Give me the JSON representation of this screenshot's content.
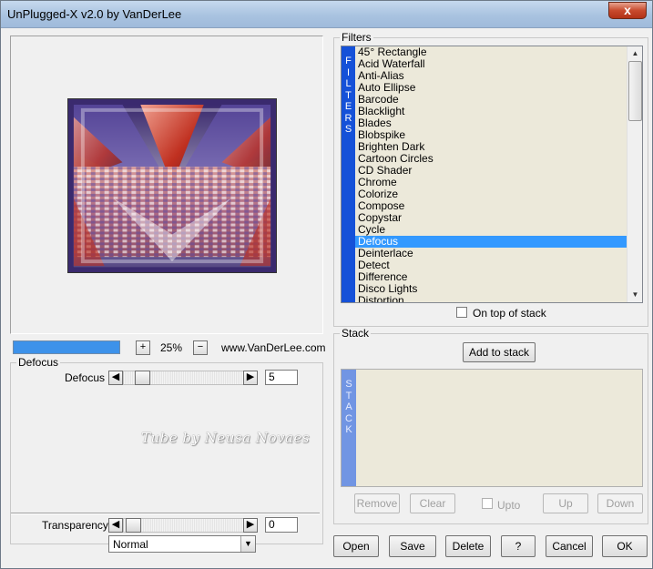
{
  "window": {
    "title": "UnPlugged-X v2.0 by VanDerLee",
    "close_glyph": "x"
  },
  "preview": {
    "zoom": "25%",
    "zoom_in": "+",
    "zoom_out": "−",
    "website": "www.VanDerLee.com",
    "progress_fraction": 1.0
  },
  "params": {
    "group_label": "Defocus",
    "defocus_label": "Defocus",
    "defocus_value": "5",
    "watermark": "Tube by Neusa Novaes",
    "transparency_label": "Transparency",
    "transparency_value": "0",
    "blend_mode": "Normal"
  },
  "filters": {
    "group_label": "Filters",
    "band_label": [
      "F",
      "I",
      "L",
      "T",
      "E",
      "R",
      "S"
    ],
    "items": [
      "45° Rectangle",
      "Acid Waterfall",
      "Anti-Alias",
      "Auto Ellipse",
      "Barcode",
      "Blacklight",
      "Blades",
      "Blobspike",
      "Brighten Dark",
      "Cartoon Circles",
      "CD Shader",
      "Chrome",
      "Colorize",
      "Compose",
      "Copystar",
      "Cycle",
      "Defocus",
      "Deinterlace",
      "Detect",
      "Difference",
      "Disco Lights",
      "Distortion"
    ],
    "selected": "Defocus",
    "on_top_label": "On top of stack"
  },
  "stack": {
    "group_label": "Stack",
    "add_label": "Add to stack",
    "band_label": [
      "S",
      "T",
      "A",
      "C",
      "K"
    ],
    "remove_label": "Remove",
    "clear_label": "Clear",
    "upto_label": "Upto",
    "up_label": "Up",
    "down_label": "Down"
  },
  "footer": {
    "open": "Open",
    "save": "Save",
    "delete": "Delete",
    "help": "?",
    "cancel": "Cancel",
    "ok": "OK"
  },
  "colors": {
    "accent": "#3399ff",
    "filters_band": "#1551d8",
    "stack_band": "#7195e3",
    "list_bg": "#ece9da"
  }
}
